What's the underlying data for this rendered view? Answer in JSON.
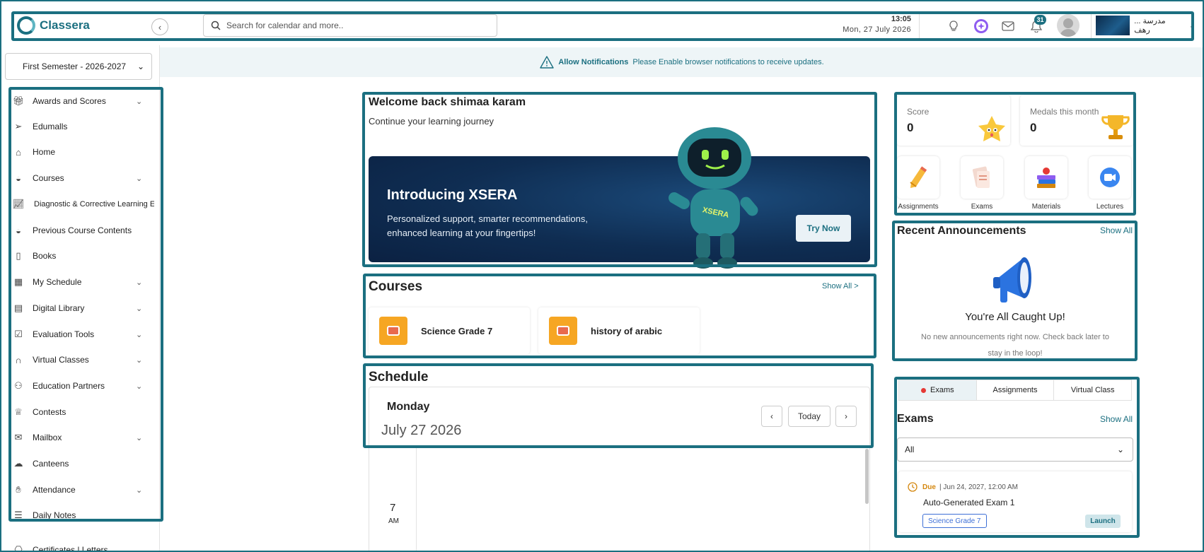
{
  "header": {
    "logo_text": "Classera",
    "search_placeholder": "Search for calendar and more..",
    "time": "13:05",
    "date": "Mon, 27 July 2026",
    "notification_count": "31",
    "school_name": "... مدرسة رهف"
  },
  "semester": {
    "selected": "First Semester - 2026-2027"
  },
  "sidebar": {
    "items": [
      {
        "label": "Awards and Scores",
        "icon": "gift-icon",
        "chevron": true
      },
      {
        "label": "Edumalls",
        "icon": "paper-plane-icon",
        "chevron": false
      },
      {
        "label": "Home",
        "icon": "home-icon",
        "chevron": false
      },
      {
        "label": "Courses",
        "icon": "courses-icon",
        "chevron": true
      },
      {
        "label": "Diagnostic & Corrective Learning E",
        "icon": "chart-line-icon",
        "chevron": false
      },
      {
        "label": "Previous Course Contents",
        "icon": "courses-icon",
        "chevron": false
      },
      {
        "label": "Books",
        "icon": "book-icon",
        "chevron": false
      },
      {
        "label": "My Schedule",
        "icon": "calendar-icon",
        "chevron": true
      },
      {
        "label": "Digital Library",
        "icon": "library-icon",
        "chevron": true
      },
      {
        "label": "Evaluation Tools",
        "icon": "checklist-icon",
        "chevron": true
      },
      {
        "label": "Virtual Classes",
        "icon": "headset-icon",
        "chevron": true
      },
      {
        "label": "Education Partners",
        "icon": "partners-icon",
        "chevron": true
      },
      {
        "label": "Contests",
        "icon": "trophy-icon",
        "chevron": false
      },
      {
        "label": "Mailbox",
        "icon": "mail-icon",
        "chevron": true
      },
      {
        "label": "Canteens",
        "icon": "chef-hat-icon",
        "chevron": false
      },
      {
        "label": "Attendance",
        "icon": "hand-icon",
        "chevron": true
      },
      {
        "label": "Daily Notes",
        "icon": "notes-icon",
        "chevron": false
      },
      {
        "label": "Certificates | Letters",
        "icon": "certificate-icon",
        "chevron": true
      }
    ]
  },
  "notification_banner": {
    "title": "Allow Notifications",
    "text": "Please Enable browser notifications to receive updates."
  },
  "welcome": {
    "title": "Welcome back shimaa karam",
    "subtitle": "Continue your learning journey",
    "banner_title": "Introducing XSERA",
    "banner_text": "Personalized support, smarter recommendations, enhanced learning at your fingertips!",
    "banner_button": "Try Now",
    "robot_label": "XSERA"
  },
  "courses": {
    "title": "Courses",
    "show_all": "Show All  >",
    "items": [
      {
        "name": "Science Grade 7"
      },
      {
        "name": "history of arabic"
      }
    ]
  },
  "schedule": {
    "title": "Schedule",
    "day": "Monday",
    "date": "July 27 2026",
    "today_label": "Today",
    "hour": "7",
    "ampm": "AM"
  },
  "stats": {
    "score_label": "Score",
    "score_value": "0",
    "medals_label": "Medals this month",
    "medals_value": "0"
  },
  "quick_links": [
    {
      "label": "Assignments",
      "icon": "pencil-icon"
    },
    {
      "label": "Exams",
      "icon": "exam-paper-icon"
    },
    {
      "label": "Materials",
      "icon": "books-icon"
    },
    {
      "label": "Lectures",
      "icon": "video-camera-icon"
    }
  ],
  "announcements": {
    "title": "Recent Announcements",
    "show_all": "Show All",
    "empty_title": "You're All Caught Up!",
    "empty_text": "No new announcements right now. Check back later to stay in the loop!"
  },
  "exams_panel": {
    "tabs": [
      "Exams",
      "Assignments",
      "Virtual Class"
    ],
    "active_tab": "Exams",
    "title": "Exams",
    "show_all": "Show All",
    "filter_value": "All",
    "exam": {
      "status": "Due",
      "date": "| Jun 24, 2027, 12:00 AM",
      "name": "Auto-Generated Exam 1",
      "course": "Science Grade 7",
      "action": "Launch"
    }
  },
  "colors": {
    "brand": "#1b6f80",
    "banner_bg": "#0f2d52",
    "course_icon": "#f6a623",
    "due": "#d4870e",
    "active_dot": "#e53935"
  }
}
